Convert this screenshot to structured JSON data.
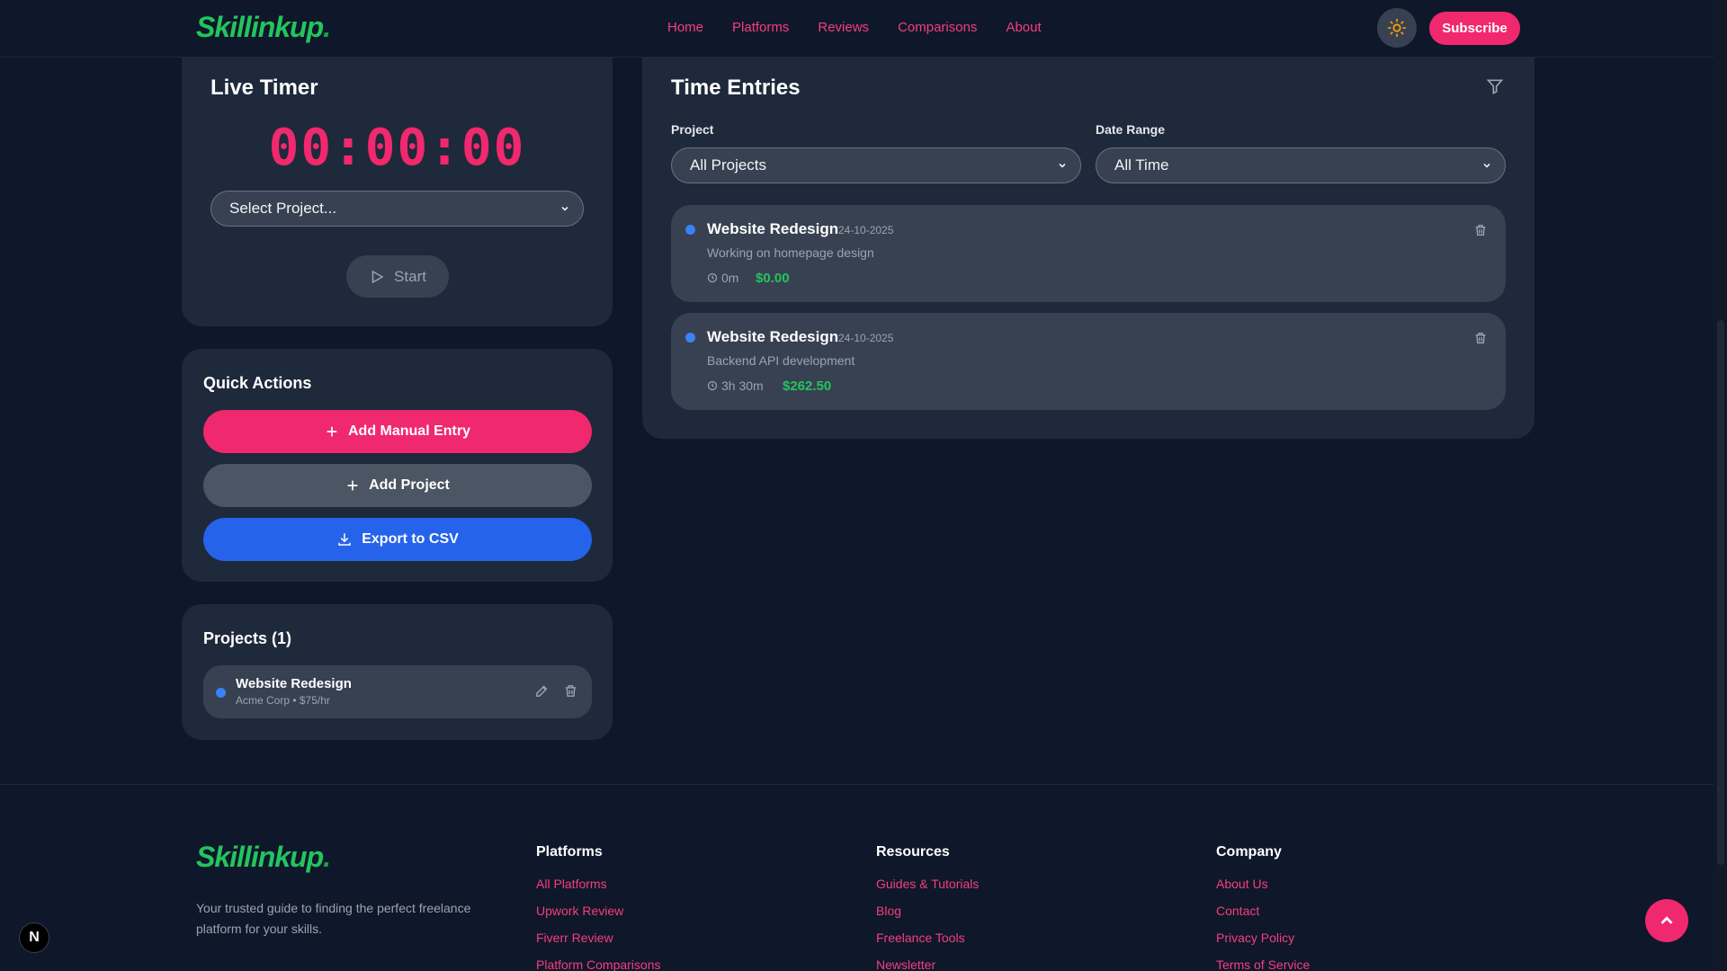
{
  "brand": {
    "logo": "Skillinkup",
    "logo_dot": "."
  },
  "nav": [
    "Home",
    "Platforms",
    "Reviews",
    "Comparisons",
    "About"
  ],
  "header": {
    "subscribe": "Subscribe",
    "theme_icon": "sun-icon"
  },
  "timer": {
    "title": "Live Timer",
    "display": "00:00:00",
    "project_select": "Select Project...",
    "start": "Start"
  },
  "quick_actions": {
    "title": "Quick Actions",
    "add_manual": "Add Manual Entry",
    "add_project": "Add Project",
    "export": "Export to CSV"
  },
  "projects": {
    "title": "Projects (1)",
    "items": [
      {
        "name": "Website Redesign",
        "meta": "Acme Corp • $75/hr"
      }
    ]
  },
  "entries": {
    "title": "Time Entries",
    "filter_project_label": "Project",
    "filter_project_value": "All Projects",
    "filter_date_label": "Date Range",
    "filter_date_value": "All Time",
    "items": [
      {
        "title": "Website Redesign",
        "date": "24-10-2025",
        "desc": "Working on homepage design",
        "duration": "0m",
        "amount": "$0.00"
      },
      {
        "title": "Website Redesign",
        "date": "24-10-2025",
        "desc": "Backend API development",
        "duration": "3h 30m",
        "amount": "$262.50"
      }
    ]
  },
  "footer": {
    "tagline": "Your trusted guide to finding the perfect freelance platform for your skills.",
    "columns": [
      {
        "title": "Platforms",
        "links": [
          "All Platforms",
          "Upwork Review",
          "Fiverr Review",
          "Platform Comparisons"
        ]
      },
      {
        "title": "Resources",
        "links": [
          "Guides & Tutorials",
          "Blog",
          "Freelance Tools",
          "Newsletter"
        ]
      },
      {
        "title": "Company",
        "links": [
          "About Us",
          "Contact",
          "Privacy Policy",
          "Terms of Service"
        ]
      }
    ]
  },
  "badge": "N",
  "colors": {
    "accent": "#f0286d",
    "brand": "#22c55e",
    "blue": "#2563eb",
    "card": "#1e293b",
    "bg": "#0f172a"
  }
}
